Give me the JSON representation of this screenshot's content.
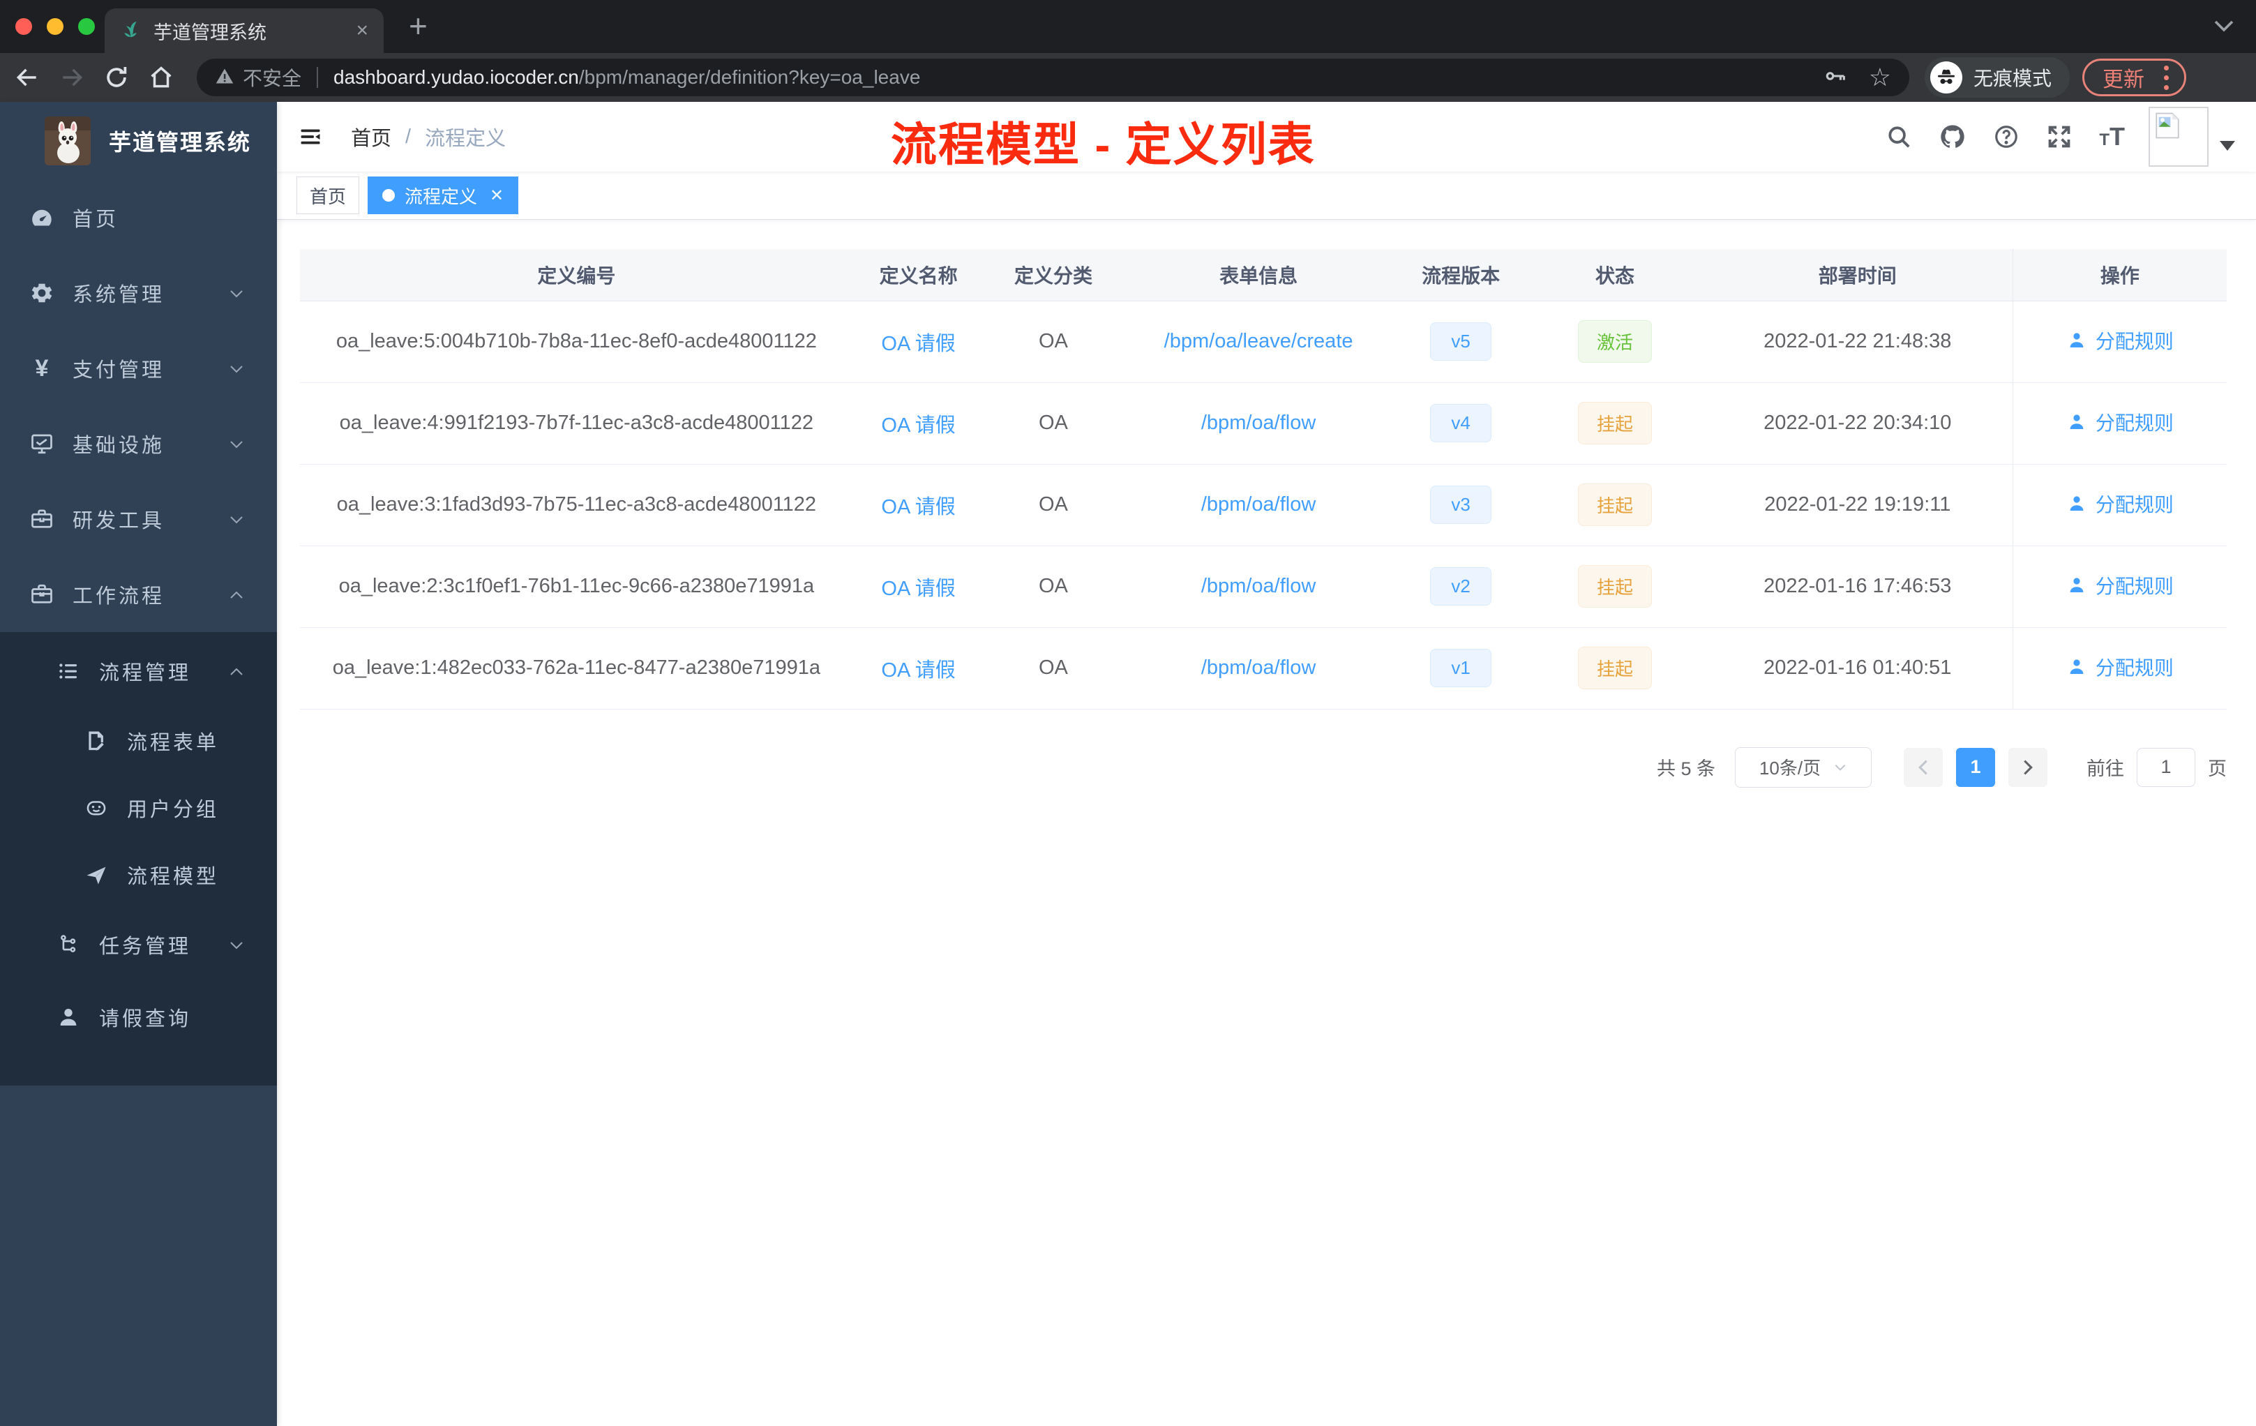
{
  "browser": {
    "tab": {
      "title": "芋道管理系统",
      "close": "×",
      "new_tab": "+"
    },
    "address": {
      "security_label": "不安全",
      "domain": "dashboard.yudao.iocoder.cn",
      "path": "/bpm/manager/definition?key=oa_leave"
    },
    "incognito_label": "无痕模式",
    "update_label": "更新"
  },
  "sidebar": {
    "logo_title": "芋道管理系统",
    "items": [
      {
        "label": "首页"
      },
      {
        "label": "系统管理"
      },
      {
        "label": "支付管理"
      },
      {
        "label": "基础设施"
      },
      {
        "label": "研发工具"
      },
      {
        "label": "工作流程"
      },
      {
        "label": "流程管理"
      },
      {
        "label": "流程表单"
      },
      {
        "label": "用户分组"
      },
      {
        "label": "流程模型"
      },
      {
        "label": "任务管理"
      },
      {
        "label": "请假查询"
      }
    ]
  },
  "navbar": {
    "breadcrumb": {
      "home": "首页",
      "separator": "/",
      "current": "流程定义"
    }
  },
  "annotation": {
    "text": "流程模型 - 定义列表",
    "color": "#fb2b10"
  },
  "tags_view": {
    "tabs": [
      {
        "label": "首页",
        "active": false
      },
      {
        "label": "流程定义",
        "active": true
      }
    ]
  },
  "table": {
    "columns": [
      "定义编号",
      "定义名称",
      "定义分类",
      "表单信息",
      "流程版本",
      "状态",
      "部署时间",
      "操作"
    ],
    "rows": [
      {
        "id": "oa_leave:5:004b710b-7b8a-11ec-8ef0-acde48001122",
        "name": "OA 请假",
        "category": "OA",
        "form": "/bpm/oa/leave/create",
        "version": "v5",
        "status": "激活",
        "status_type": "success",
        "deploy_time": "2022-01-22 21:48:38",
        "action": "分配规则"
      },
      {
        "id": "oa_leave:4:991f2193-7b7f-11ec-a3c8-acde48001122",
        "name": "OA 请假",
        "category": "OA",
        "form": "/bpm/oa/flow",
        "version": "v4",
        "status": "挂起",
        "status_type": "warning",
        "deploy_time": "2022-01-22 20:34:10",
        "action": "分配规则"
      },
      {
        "id": "oa_leave:3:1fad3d93-7b75-11ec-a3c8-acde48001122",
        "name": "OA 请假",
        "category": "OA",
        "form": "/bpm/oa/flow",
        "version": "v3",
        "status": "挂起",
        "status_type": "warning",
        "deploy_time": "2022-01-22 19:19:11",
        "action": "分配规则"
      },
      {
        "id": "oa_leave:2:3c1f0ef1-76b1-11ec-9c66-a2380e71991a",
        "name": "OA 请假",
        "category": "OA",
        "form": "/bpm/oa/flow",
        "version": "v2",
        "status": "挂起",
        "status_type": "warning",
        "deploy_time": "2022-01-16 17:46:53",
        "action": "分配规则"
      },
      {
        "id": "oa_leave:1:482ec033-762a-11ec-8477-a2380e71991a",
        "name": "OA 请假",
        "category": "OA",
        "form": "/bpm/oa/flow",
        "version": "v1",
        "status": "挂起",
        "status_type": "warning",
        "deploy_time": "2022-01-16 01:40:51",
        "action": "分配规则"
      }
    ]
  },
  "pagination": {
    "total": "共 5 条",
    "page_size": "10条/页",
    "current_page": "1",
    "goto_label": "前往",
    "goto_value": "1",
    "page_unit": "页"
  },
  "colors": {
    "accent": "#409eff",
    "success": "#67c23a",
    "warning": "#e6a23c",
    "sidebar_bg": "#304156",
    "submenu_bg": "#1f2d3d",
    "annotation_red": "#fb2b10"
  }
}
